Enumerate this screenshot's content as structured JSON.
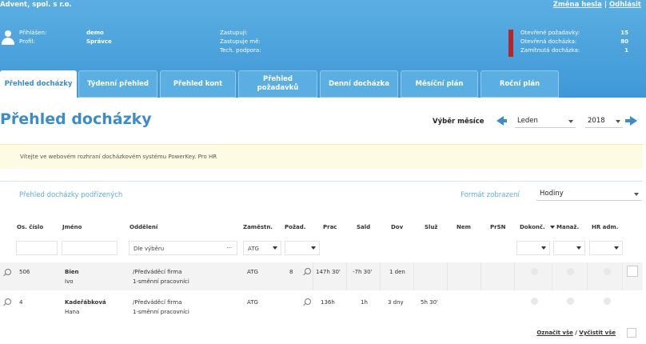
{
  "header": {
    "company": "Advent, spol. s r.o.",
    "change_password": "Změna hesla",
    "separator": "|",
    "logout": "Odhlásit"
  },
  "user": {
    "logged_label": "Přihlášen:",
    "logged_value": "demo",
    "profile_label": "Profil:",
    "profile_value": "Správce",
    "zastupuji": "Zastupuji:",
    "zastupuje_me": "Zastupuje mě:",
    "tech_podpora": "Tech. podpora:"
  },
  "stats": [
    {
      "label": "Otevřené požadavky:",
      "value": "15"
    },
    {
      "label": "Otevřená docházka:",
      "value": "80"
    },
    {
      "label": "Zamítnutá docházka:",
      "value": "1"
    }
  ],
  "tabs": [
    {
      "label": "Přehled docházky",
      "active": true
    },
    {
      "label": "Týdenní přehled"
    },
    {
      "label": "Přehled kont"
    },
    {
      "label": "Přehled požadavků"
    },
    {
      "label": "Denní docházka"
    },
    {
      "label": "Měsíční plán"
    },
    {
      "label": "Roční plán"
    }
  ],
  "page": {
    "title": "Přehled docházky",
    "month_select_label": "Výběr měsíce",
    "month": "Leden",
    "year": "2018"
  },
  "banner": "Vítejte ve webovém rozhraní docházkovém systému PowerKey. Pro HR",
  "panel": {
    "title": "Přehled docházky podřízených",
    "format_label": "Formát zobrazení",
    "format_value": "Hodiny"
  },
  "columns": [
    "Os. číslo",
    "Jméno",
    "Oddělení",
    "Zaměstn.",
    "Požad.",
    "Prac",
    "Sald",
    "Dov",
    "Služ",
    "Nem",
    "PrSN",
    "Dokonč.",
    "Manaž.",
    "HR adm."
  ],
  "filters": {
    "department": "Dle výběru",
    "department_dots": "···",
    "employer": "ATG"
  },
  "rows": [
    {
      "os_cislo": "506",
      "surname": "Bien",
      "firstname": "Ivo",
      "dept1": "/Předváděcí firma",
      "dept2": "1-směnní pracovníci",
      "employer": "ATG",
      "pozad": "8",
      "prac": "147h 30'",
      "sald": "-7h 30'",
      "dov": "1 den",
      "sluz": ""
    },
    {
      "os_cislo": "4",
      "surname": "Kadeřábková",
      "firstname": "Hana",
      "dept1": "/Předváděcí firma",
      "dept2": "1-směnní pracovníci",
      "employer": "ATG",
      "pozad": "",
      "prac": "136h",
      "sald": "1h",
      "dov": "3 dny",
      "sluz": "5h 30'"
    }
  ],
  "footer": {
    "select_all": "Označit vše",
    "slash": "/",
    "clear_all": "Vyčistit vše"
  },
  "colors": {
    "accent": "#3a8ccc",
    "header": "#4ea4dd",
    "alert": "#b3262c"
  }
}
